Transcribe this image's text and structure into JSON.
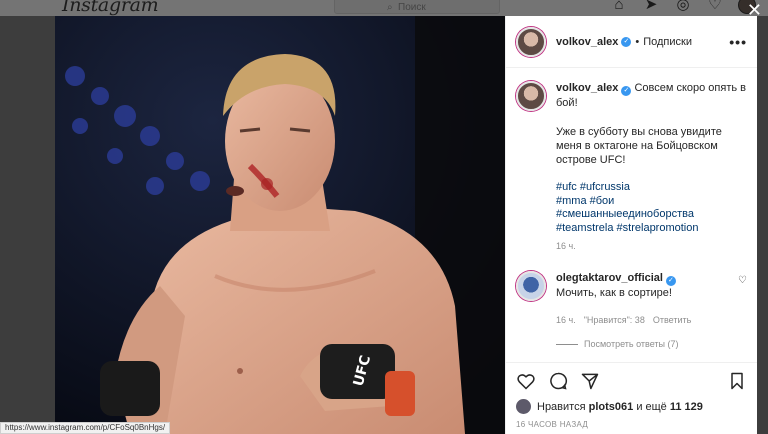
{
  "topbar": {
    "logo": "Instagram",
    "search_placeholder": "Поиск",
    "icons": [
      "home-icon",
      "direct-icon",
      "explore-icon",
      "heart-icon",
      "profile-avatar"
    ]
  },
  "post": {
    "author": "volkov_alex",
    "follow_dot": "•",
    "follow_label": "Подписки",
    "more": "•••",
    "caption_lead": "Совсем скоро опять в бой!",
    "caption_body": "Уже в субботу вы снова увидите меня в октагоне на Бойцовском острове UFC!",
    "hashtags": [
      "#ufc",
      "#ufcrussia",
      "#mma",
      "#бои",
      "#смешанныеединоборства",
      "#teamstrela",
      "#strelapromotion"
    ],
    "time": "16 ч.",
    "comment": {
      "author": "olegtaktarov_official",
      "text": "Мочить, как в сортире!",
      "time": "16 ч.",
      "likes": "\"Нравится\": 38",
      "reply": "Ответить",
      "view_replies": "Посмотреть ответы (7)"
    },
    "likes_prefix": "Нравится",
    "likes_user": "plots061",
    "likes_suffix": "и ещё",
    "likes_count": "11 129",
    "ago": "16 ЧАСОВ НАЗАД"
  },
  "status_url": "https://www.instagram.com/p/CFoSq0BnHgs/",
  "colors": {
    "verified": "#3897f0",
    "hashtag": "#00376b",
    "muted": "#8e8e8e"
  }
}
